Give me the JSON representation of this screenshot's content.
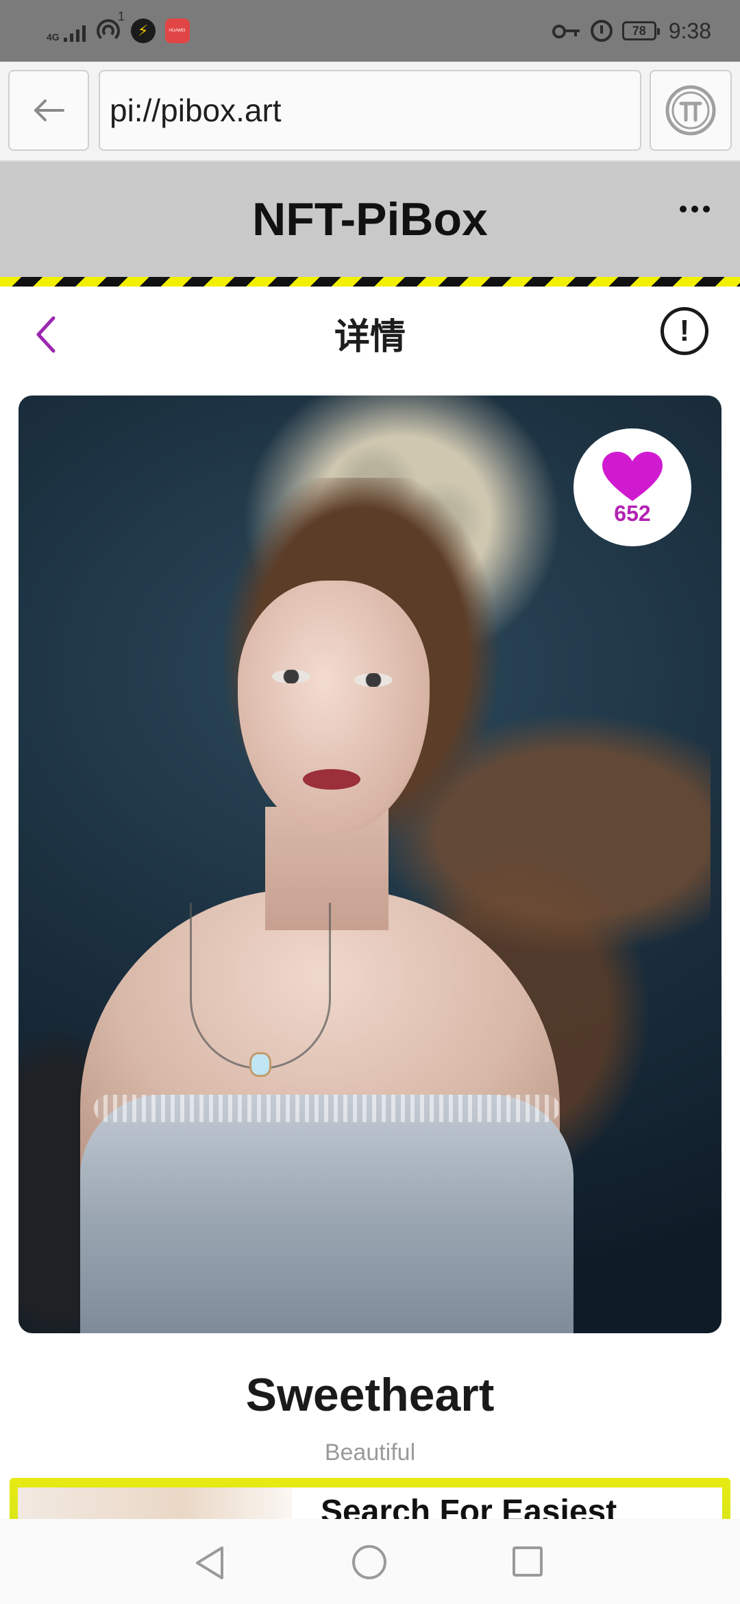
{
  "status_bar": {
    "network_label": "4G",
    "notification_badge": "1",
    "huawei_label": "HUAWEI",
    "battery_level": "78",
    "time": "9:38"
  },
  "browser": {
    "url": "pi://pibox.art"
  },
  "app_header": {
    "title": "NFT-PiBox"
  },
  "page_header": {
    "title": "详情",
    "info_symbol": "!"
  },
  "artwork": {
    "like_count": "652"
  },
  "nft": {
    "title": "Sweetheart",
    "subtitle": "Beautiful"
  },
  "promo": {
    "text": "Search For Easiest"
  },
  "colors": {
    "accent_purple": "#9b27b0",
    "like_magenta": "#d01ad0",
    "hazard_yellow": "#f2ef00"
  }
}
